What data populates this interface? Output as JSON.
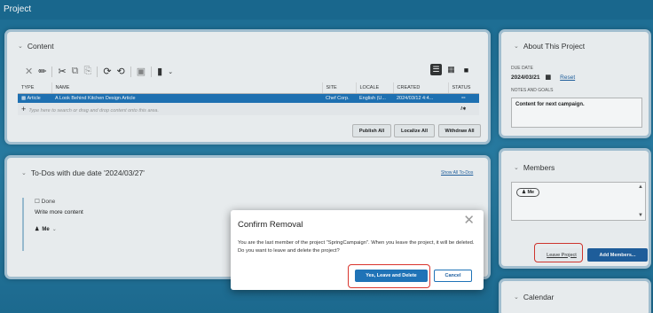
{
  "app": {
    "title": "Project"
  },
  "content_panel": {
    "title": "Content",
    "columns": [
      "TYPE",
      "NAME",
      "SITE",
      "LOCALE",
      "CREATED",
      "STATUS"
    ],
    "rows": [
      {
        "type": "Article",
        "name": "A Look Behind Kitchen Design Article",
        "site": "Chef Corp.",
        "locale": "English (U...",
        "created": "2024/03/12 4:4..."
      }
    ],
    "drop_placeholder": "Type here to search or drag and drop content onto this area.",
    "buttons": {
      "publish_all": "Publish All",
      "localize_all": "Localize All",
      "withdraw_all": "Withdraw All"
    }
  },
  "todos_panel": {
    "title": "To-Dos with due date '2024/03/27'",
    "show_all_link": "Show All To-Dos",
    "item": {
      "checkbox_label": "Done",
      "text": "Write more content",
      "assignee": "Me"
    }
  },
  "about_panel": {
    "title": "About This Project",
    "due_date_label": "DUE DATE",
    "due_date": "2024/03/21",
    "reset_link": "Reset",
    "notes_label": "NOTES AND GOALS",
    "notes": "Content for next campaign."
  },
  "members_panel": {
    "title": "Members",
    "member": "Me",
    "leave_button": "Leave Project",
    "add_button": "Add Members..."
  },
  "calendar_panel": {
    "title": "Calendar"
  },
  "dialog": {
    "title": "Confirm Removal",
    "message": "You are the last member of the project \"SpringCampaign\". When you leave the project, it will be deleted. Do you want to leave and delete the project?",
    "confirm_button": "Yes, Leave and Delete",
    "cancel_button": "Cancel"
  },
  "colors": {
    "accent": "#1f73b7",
    "highlight": "#d9352d",
    "background": "#1d6f96"
  }
}
